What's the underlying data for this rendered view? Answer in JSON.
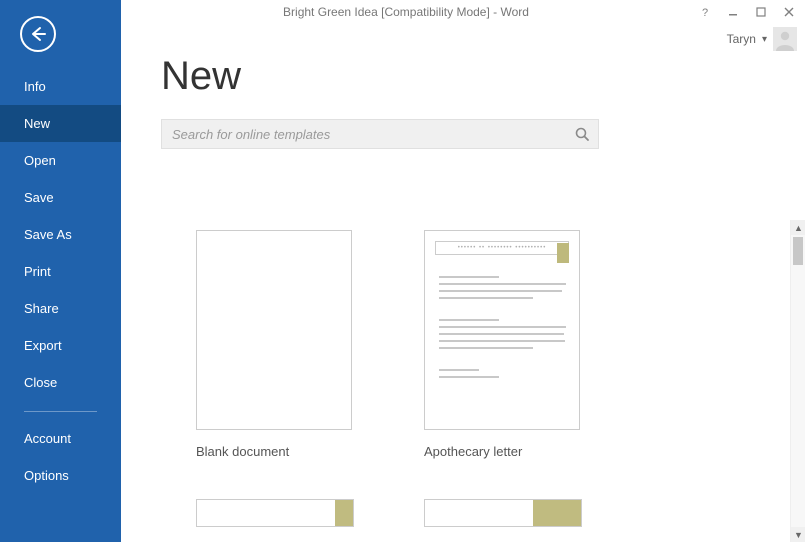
{
  "window": {
    "title": "Bright Green Idea [Compatibility Mode] - Word",
    "user": "Taryn"
  },
  "sidebar": {
    "items": [
      {
        "label": "Info"
      },
      {
        "label": "New"
      },
      {
        "label": "Open"
      },
      {
        "label": "Save"
      },
      {
        "label": "Save As"
      },
      {
        "label": "Print"
      },
      {
        "label": "Share"
      },
      {
        "label": "Export"
      },
      {
        "label": "Close"
      }
    ],
    "footerItems": [
      {
        "label": "Account"
      },
      {
        "label": "Options"
      }
    ],
    "activeIndex": 1
  },
  "page": {
    "heading": "New",
    "searchPlaceholder": "Search for online templates"
  },
  "templates": [
    {
      "label": "Blank document",
      "kind": "blank"
    },
    {
      "label": "Apothecary letter",
      "kind": "apothecary"
    }
  ]
}
